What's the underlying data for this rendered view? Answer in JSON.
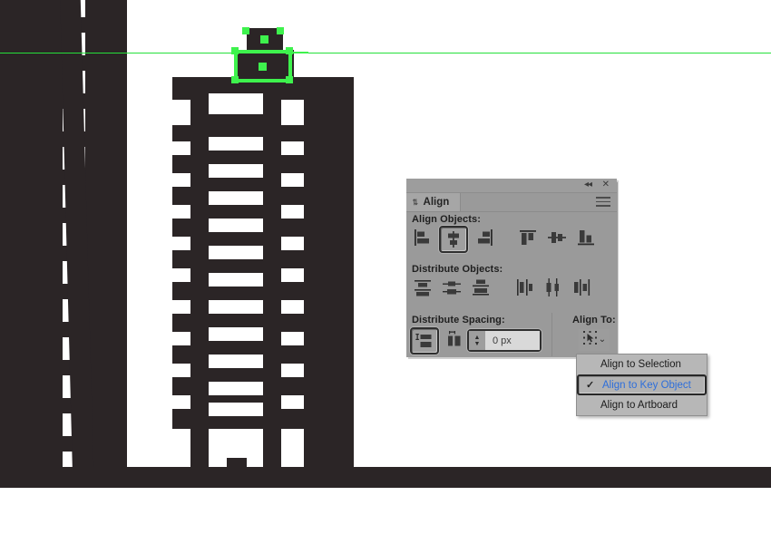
{
  "app": {
    "panel_title": "Align",
    "titlebar": {
      "collapse_icon": "double-left-chevron-icon",
      "collapse_glyph": "◂◂",
      "close_icon": "close-icon",
      "close_glyph": "✕",
      "menu_icon": "panel-menu-hamburger-icon",
      "tab_caret_glyph": "⇅"
    },
    "sections": {
      "align_objects": {
        "label": "Align Objects:",
        "buttons": [
          {
            "name": "horizontal-align-left",
            "icon": "align-left-icon",
            "selected": false
          },
          {
            "name": "horizontal-align-center",
            "icon": "align-horizontal-center-icon",
            "selected": true
          },
          {
            "name": "horizontal-align-right",
            "icon": "align-right-icon",
            "selected": false
          },
          {
            "name": "vertical-align-top",
            "icon": "align-top-icon",
            "selected": false
          },
          {
            "name": "vertical-align-center",
            "icon": "align-vertical-center-icon",
            "selected": false
          },
          {
            "name": "vertical-align-bottom",
            "icon": "align-bottom-icon",
            "selected": false
          }
        ]
      },
      "distribute_objects": {
        "label": "Distribute Objects:",
        "buttons": [
          {
            "name": "vertical-distribute-top",
            "icon": "distribute-top-icon",
            "selected": false
          },
          {
            "name": "vertical-distribute-center",
            "icon": "distribute-vertical-center-icon",
            "selected": false
          },
          {
            "name": "vertical-distribute-bottom",
            "icon": "distribute-bottom-icon",
            "selected": false
          },
          {
            "name": "horizontal-distribute-left",
            "icon": "distribute-left-icon",
            "selected": false
          },
          {
            "name": "horizontal-distribute-center",
            "icon": "distribute-horizontal-center-icon",
            "selected": false
          },
          {
            "name": "horizontal-distribute-right",
            "icon": "distribute-right-icon",
            "selected": false
          }
        ]
      },
      "distribute_spacing": {
        "label": "Distribute Spacing:",
        "buttons": [
          {
            "name": "vertical-distribute-spacing",
            "icon": "distribute-spacing-vertical-icon",
            "selected": true
          },
          {
            "name": "horizontal-distribute-spacing",
            "icon": "distribute-spacing-horizontal-icon",
            "selected": false
          }
        ],
        "spacing_value": "0 px",
        "stepper_up_glyph": "▲",
        "stepper_down_glyph": "▼"
      },
      "align_to": {
        "label": "Align To:",
        "button_icon": "align-to-key-object-icon",
        "chevron_glyph": "⌄"
      }
    },
    "dropdown": {
      "items": [
        {
          "label": "Align to Selection",
          "checked": false
        },
        {
          "label": "Align to Key Object",
          "checked": true
        },
        {
          "label": "Align to Artboard",
          "checked": false
        }
      ],
      "check_glyph": "✓"
    }
  },
  "colors": {
    "artwork_dark": "#2b2526",
    "selection_green": "#3ef24d",
    "guide_green": "#25e03a",
    "panel_bg": "#9a9a9a",
    "highlight_text_blue": "#2d6edb",
    "canvas_bg": "#ffffff"
  },
  "artwork": {
    "description": "city skyline vector illustration",
    "selected_object": "penthouse-rectangle",
    "guide_line": "horizontal-smart-guide"
  }
}
